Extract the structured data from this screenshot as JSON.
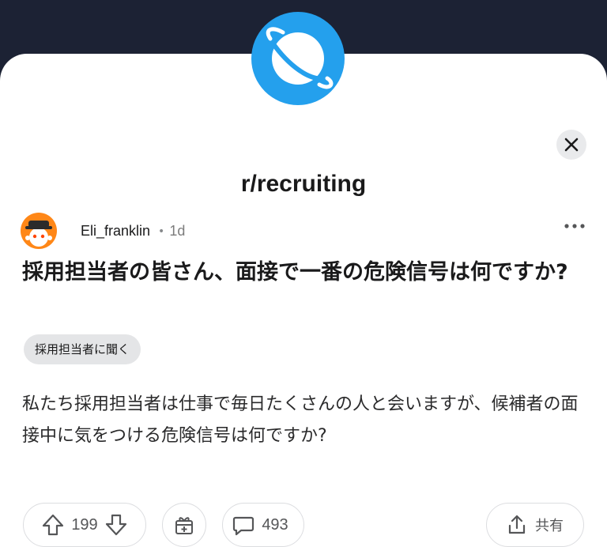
{
  "header": {
    "subreddit": "r/recruiting"
  },
  "post": {
    "author": "Eli_franklin",
    "separator": "•",
    "age": "1d",
    "title": "採用担当者の皆さん、面接で一番の危険信号は何ですか?",
    "flair": "採用担当者に聞く",
    "body": "私たち採用担当者は仕事で毎日たくさんの人と会いますが、候補者の面接中に気をつける危険信号は何ですか?"
  },
  "actions": {
    "upvotes": "199",
    "comments": "493",
    "share_label": "共有"
  },
  "icons": {
    "subreddit_avatar": "planet-icon",
    "close": "close-icon",
    "more": "more-options-icon",
    "upvote": "upvote-arrow-icon",
    "downvote": "downvote-arrow-icon",
    "award": "gift-award-icon",
    "comment": "comment-bubble-icon",
    "share": "share-icon"
  },
  "colors": {
    "top_band": "#1c2234",
    "subreddit_blue": "#24a0ed",
    "avatar_orange": "#ff8717",
    "flair_bg": "#e4e5e7"
  }
}
